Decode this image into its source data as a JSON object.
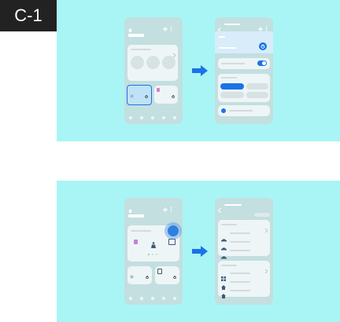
{
  "label": "C-1",
  "colors": {
    "panel_bg": "#a9f5f5",
    "phone_bg": "#c3dfe0",
    "accent_blue": "#1a73e8",
    "highlight": "#2f7fe0"
  },
  "icons": [
    "home-icon",
    "plus-icon",
    "more-icon",
    "back-icon",
    "power-icon",
    "toggle-icon",
    "arrow-right-icon",
    "chevron-right-icon",
    "car-icon",
    "grid-icon",
    "house-icon",
    "bed-icon",
    "tv-icon",
    "fan-icon",
    "fridge-icon"
  ]
}
